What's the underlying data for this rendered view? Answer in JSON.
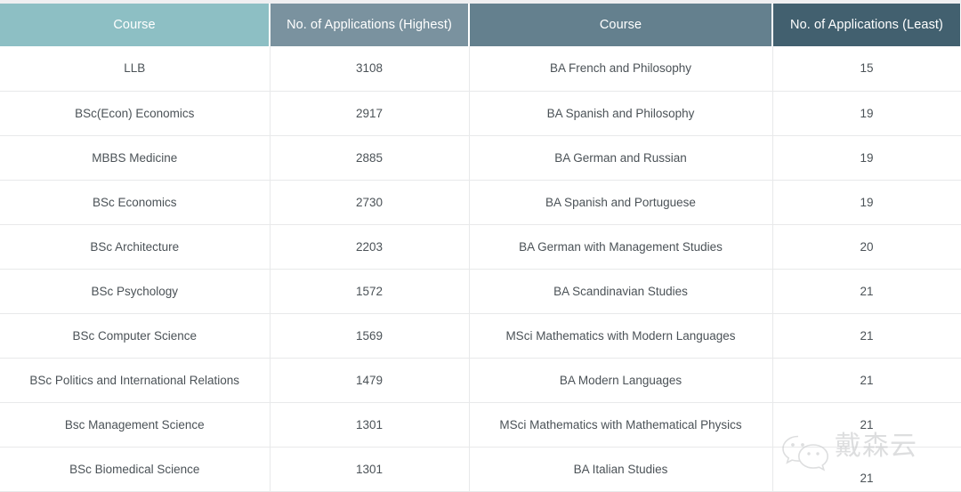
{
  "table": {
    "headers": [
      {
        "label": "Course",
        "color": "#8dbfc4"
      },
      {
        "label": "No. of Applications (Highest)",
        "color": "#7a929f"
      },
      {
        "label": "Course",
        "color": "#64808e"
      },
      {
        "label": "No. of Applications (Least)",
        "color": "#42606f"
      }
    ],
    "rows": [
      {
        "course_high": "LLB",
        "apps_high": "3108",
        "course_low": "BA French and Philosophy",
        "apps_low": "15"
      },
      {
        "course_high": "BSc(Econ) Economics",
        "apps_high": "2917",
        "course_low": "BA Spanish and Philosophy",
        "apps_low": "19"
      },
      {
        "course_high": "MBBS Medicine",
        "apps_high": "2885",
        "course_low": "BA German and Russian",
        "apps_low": "19"
      },
      {
        "course_high": "BSc Economics",
        "apps_high": "2730",
        "course_low": "BA Spanish and Portuguese",
        "apps_low": "19"
      },
      {
        "course_high": "BSc Architecture",
        "apps_high": "2203",
        "course_low": "BA German with Management Studies",
        "apps_low": "20"
      },
      {
        "course_high": "BSc Psychology",
        "apps_high": "1572",
        "course_low": "BA Scandinavian Studies",
        "apps_low": "21"
      },
      {
        "course_high": "BSc Computer Science",
        "apps_high": "1569",
        "course_low": "MSci Mathematics with Modern Languages",
        "apps_low": "21"
      },
      {
        "course_high": "BSc Politics and International Relations",
        "apps_high": "1479",
        "course_low": "BA Modern Languages",
        "apps_low": "21"
      },
      {
        "course_high": "Bsc Management Science",
        "apps_high": "1301",
        "course_low": "MSci Mathematics with Mathematical Physics",
        "apps_low": "21"
      },
      {
        "course_high": "BSc Biomedical Science",
        "apps_high": "1301",
        "course_low": "BA Italian Studies",
        "apps_low": "21"
      }
    ]
  },
  "watermark": {
    "icon": "wechat-icon",
    "text": "戴森云",
    "color": "#c9cacc"
  }
}
